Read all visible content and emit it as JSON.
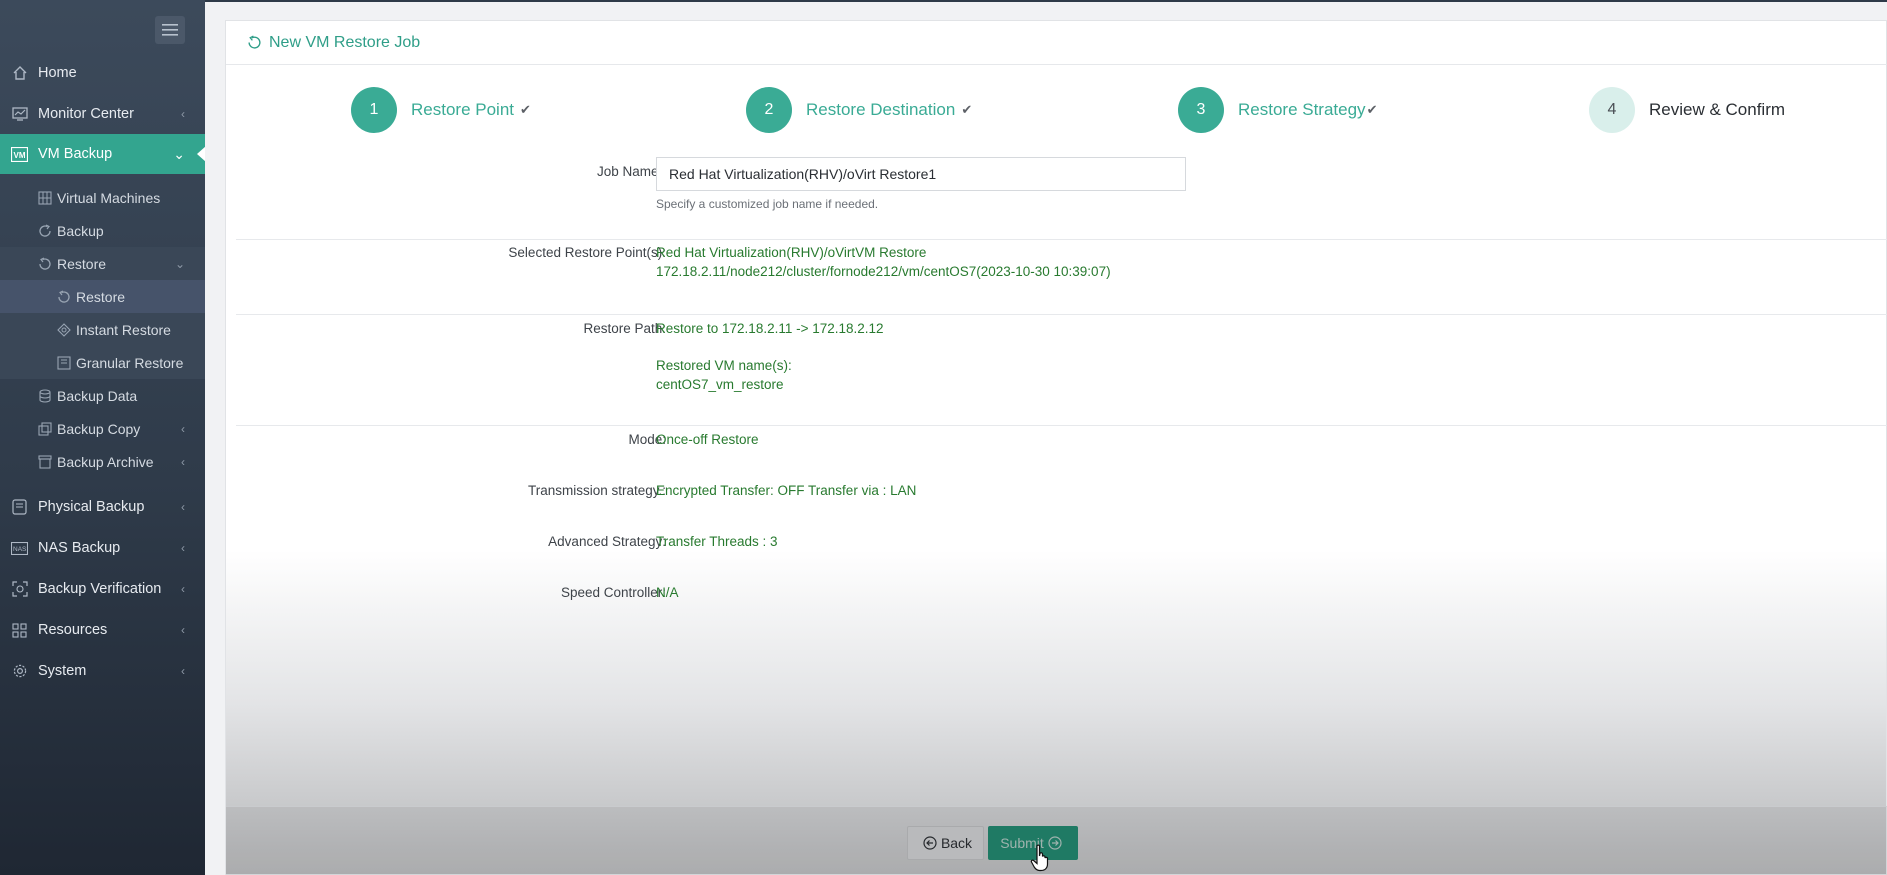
{
  "sidebar": {
    "items": [
      {
        "label": "Home",
        "icon": "home-icon"
      },
      {
        "label": "Monitor Center",
        "icon": "monitor-icon"
      },
      {
        "label": "VM Backup",
        "icon": "vm-icon"
      },
      {
        "label": "Virtual Machines",
        "icon": "grid-icon"
      },
      {
        "label": "Backup",
        "icon": "refresh-icon"
      },
      {
        "label": "Restore",
        "icon": "restore-icon"
      },
      {
        "label": "Restore",
        "icon": "restore-icon"
      },
      {
        "label": "Instant Restore",
        "icon": "instant-icon"
      },
      {
        "label": "Granular Restore",
        "icon": "granular-icon"
      },
      {
        "label": "Backup Data",
        "icon": "database-icon"
      },
      {
        "label": "Backup Copy",
        "icon": "copy-icon"
      },
      {
        "label": "Backup Archive",
        "icon": "archive-icon"
      },
      {
        "label": "Physical Backup",
        "icon": "server-icon"
      },
      {
        "label": "NAS Backup",
        "icon": "nas-icon"
      },
      {
        "label": "Backup Verification",
        "icon": "verify-icon"
      },
      {
        "label": "Resources",
        "icon": "resources-icon"
      },
      {
        "label": "System",
        "icon": "gear-icon"
      }
    ]
  },
  "panel": {
    "title": "New VM Restore Job"
  },
  "steps": [
    {
      "num": "1",
      "label": "Restore Point",
      "state": "done"
    },
    {
      "num": "2",
      "label": "Restore Destination",
      "state": "done"
    },
    {
      "num": "3",
      "label": "Restore Strategy",
      "state": "done"
    },
    {
      "num": "4",
      "label": "Review & Confirm",
      "state": "current"
    }
  ],
  "form": {
    "job_name_label": "Job Name :",
    "job_name_value": "Red Hat Virtualization(RHV)/oVirt Restore1",
    "job_name_hint": "Specify a customized job name if needed.",
    "restore_point_label": "Selected Restore Point(s):",
    "restore_point_line1": "Red Hat Virtualization(RHV)/oVirtVM Restore",
    "restore_point_line2": "172.18.2.11/node212/cluster/fornode212/vm/centOS7(2023-10-30 10:39:07)",
    "restore_path_label": "Restore Path:",
    "restore_path_value": "Restore to 172.18.2.11 -> 172.18.2.12",
    "restored_vm_label": "Restored VM name(s):",
    "restored_vm_value": "centOS7_vm_restore",
    "mode_label": "Mode:",
    "mode_value": "Once-off Restore",
    "transmission_label": "Transmission strategy.:",
    "transmission_value": "Encrypted Transfer: OFF Transfer via : LAN",
    "advanced_label": "Advanced Strategy:",
    "advanced_value": "Transfer Threads : 3",
    "speed_label": "Speed Controller:",
    "speed_value": "N/A"
  },
  "buttons": {
    "back": "Back",
    "submit": "Submit"
  },
  "colors": {
    "accent": "#3aab95",
    "value_text": "#287a2f",
    "sidebar_bg": "#2f3b4a"
  }
}
